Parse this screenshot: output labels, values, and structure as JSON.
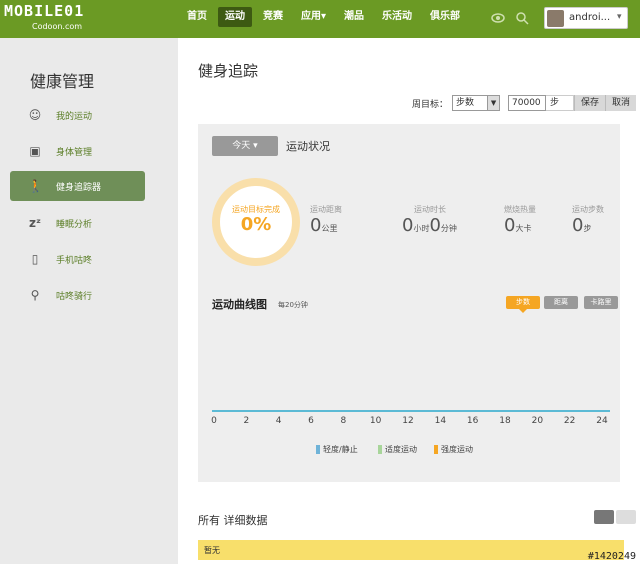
{
  "brand": {
    "logo_text": "MOBILE01",
    "site": "Codoon.com"
  },
  "nav": {
    "items": [
      "首页",
      "运动",
      "竞赛",
      "应用▾",
      "潮品",
      "乐活动",
      "俱乐部"
    ],
    "active": "运动"
  },
  "user": {
    "name": "androi...",
    "caret": "▾"
  },
  "sidebar": {
    "title": "健康管理",
    "items": [
      {
        "label": "我的运动",
        "icon": "smiley-icon",
        "active": false
      },
      {
        "label": "身体管理",
        "icon": "scale-icon",
        "active": false
      },
      {
        "label": "健身追踪器",
        "icon": "walker-icon",
        "active": true
      },
      {
        "label": "睡眠分析",
        "icon": "sleep-icon",
        "active": false
      },
      {
        "label": "手机咕咚",
        "icon": "phone-icon",
        "active": false
      },
      {
        "label": "咕咚骑行",
        "icon": "bike-icon",
        "active": false
      }
    ]
  },
  "main": {
    "title": "健身追踪",
    "goal": {
      "label": "周目标：",
      "type": "步数",
      "value": "70000",
      "unit": "步",
      "save": "保存",
      "cancel": "取消"
    },
    "panel": {
      "day_button": "今天 ▾",
      "status_title": "运动状况",
      "ring": {
        "label": "运动目标完成",
        "value": "0%"
      },
      "stats": [
        {
          "label": "运动距离",
          "value": "0",
          "unit": "公里"
        },
        {
          "label": "运动时长",
          "value": "0",
          "unit": "小时",
          "value2": "0",
          "unit2": "分钟"
        },
        {
          "label": "燃烧热量",
          "value": "0",
          "unit": "大卡"
        },
        {
          "label": "运动步数",
          "value": "0",
          "unit": "步"
        }
      ],
      "curve_title": "运动曲线图",
      "curve_sub": "每20分钟",
      "tabs": {
        "steps": "步数",
        "distance": "距离",
        "calories": "卡路里"
      },
      "x_ticks": [
        "0",
        "2",
        "4",
        "6",
        "8",
        "10",
        "12",
        "14",
        "16",
        "18",
        "20",
        "22",
        "24"
      ],
      "legend": [
        {
          "label": "轻度/静止",
          "color": "#6fb3d8"
        },
        {
          "label": "适度运动",
          "color": "#a8d59a"
        },
        {
          "label": "强度运动",
          "color": "#f5a623"
        }
      ]
    },
    "detail_title": "所有 详细数据",
    "empty_text": "暂无"
  },
  "watermark": "#1420249",
  "colors": {
    "nav_green": "#6b9a24",
    "accent_orange": "#f5a623",
    "active_side": "#6f8f58"
  }
}
